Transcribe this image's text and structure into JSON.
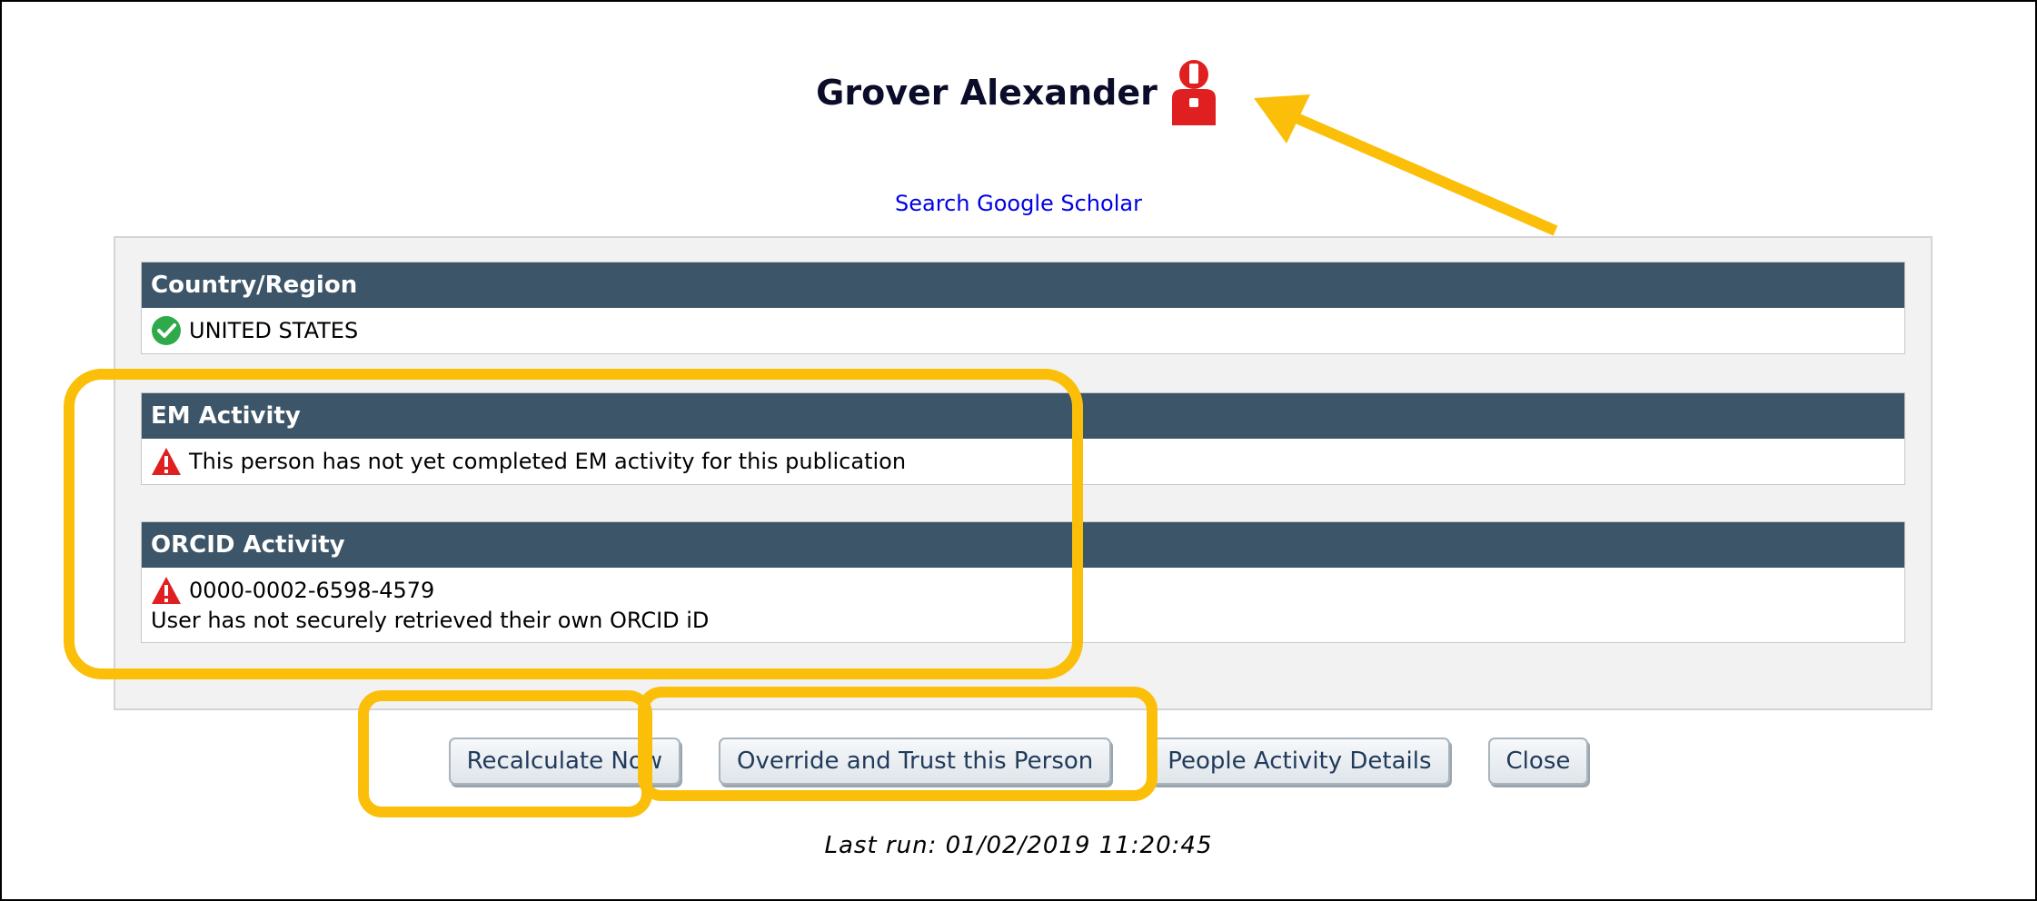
{
  "header": {
    "name": "Grover Alexander",
    "alert_icon": "person-alert-icon",
    "scholar_link": "Search Google Scholar"
  },
  "sections": [
    {
      "title": "Country/Region",
      "icon": "green-check-icon",
      "lines": [
        "UNITED STATES"
      ]
    },
    {
      "title": "EM Activity",
      "icon": "red-warning-icon",
      "lines": [
        "This person has not yet completed EM activity for this publication"
      ]
    },
    {
      "title": "ORCID Activity",
      "icon": "red-warning-icon",
      "lines": [
        "0000-0002-6598-4579",
        "User has not securely retrieved their own ORCID iD"
      ]
    }
  ],
  "buttons": {
    "recalculate": "Recalculate Now",
    "override": "Override and Trust this Person",
    "details": "People Activity Details",
    "close": "Close"
  },
  "footer": {
    "last_run": "Last run: 01/02/2019 11:20:45"
  },
  "colors": {
    "section_header": "#3c5568",
    "link": "#0000e6",
    "alert_red": "#e02020",
    "check_green": "#2eaa4a",
    "highlight_annotation": "#fbbf0a"
  }
}
